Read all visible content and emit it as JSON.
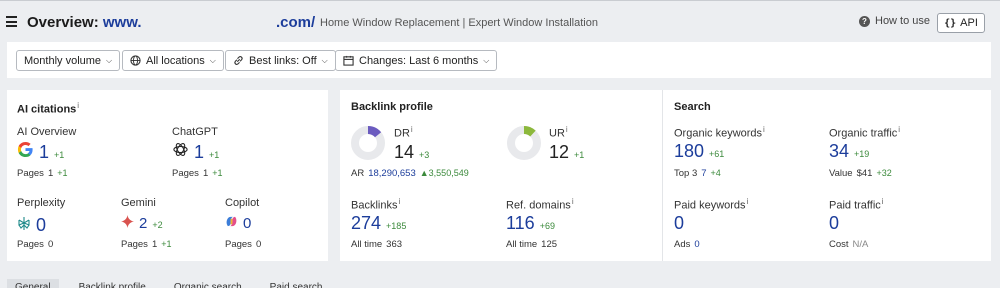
{
  "header": {
    "title_prefix": "Overview:",
    "domain_start": "www.",
    "domain_end": ".com/",
    "page_description": "Home Window Replacement | Expert Window Installation",
    "help_label": "How to use",
    "api_label": "API"
  },
  "filters": {
    "volume": "Monthly volume",
    "locations": "All locations",
    "best_links": "Best links: Off",
    "changes": "Changes: Last 6 months"
  },
  "ai_citations": {
    "title": "AI citations",
    "ai_overview": {
      "label": "AI Overview",
      "value": "1",
      "delta": "+1",
      "pages_label": "Pages",
      "pages": "1",
      "pages_delta": "+1"
    },
    "chatgpt": {
      "label": "ChatGPT",
      "value": "1",
      "delta": "+1",
      "pages_label": "Pages",
      "pages": "1",
      "pages_delta": "+1"
    },
    "perplexity": {
      "label": "Perplexity",
      "value": "0",
      "pages_label": "Pages",
      "pages": "0"
    },
    "gemini": {
      "label": "Gemini",
      "value": "2",
      "delta": "+2",
      "pages_label": "Pages",
      "pages": "1",
      "pages_delta": "+1"
    },
    "copilot": {
      "label": "Copilot",
      "value": "0",
      "pages_label": "Pages",
      "pages": "0"
    }
  },
  "backlink_profile": {
    "title": "Backlink profile",
    "dr": {
      "label": "DR",
      "value": "14",
      "delta": "+3",
      "fill": 0.14,
      "color": "#6b5bbf"
    },
    "ar": {
      "label": "AR",
      "value": "18,290,653",
      "delta": "3,550,549"
    },
    "ur": {
      "label": "UR",
      "value": "12",
      "delta": "+1",
      "fill": 0.12,
      "color": "#8cb83c"
    },
    "backlinks": {
      "label": "Backlinks",
      "value": "274",
      "delta": "+185",
      "sub_label": "All time",
      "sub_value": "363"
    },
    "ref_domains": {
      "label": "Ref. domains",
      "value": "116",
      "delta": "+69",
      "sub_label": "All time",
      "sub_value": "125"
    }
  },
  "search": {
    "title": "Search",
    "organic_keywords": {
      "label": "Organic keywords",
      "value": "180",
      "delta": "+61",
      "sub_label": "Top 3",
      "sub_value": "7",
      "sub_delta": "+4"
    },
    "organic_traffic": {
      "label": "Organic traffic",
      "value": "34",
      "delta": "+19",
      "sub_label": "Value",
      "sub_value": "$41",
      "sub_delta": "+32"
    },
    "paid_keywords": {
      "label": "Paid keywords",
      "value": "0",
      "sub_label": "Ads",
      "sub_value": "0"
    },
    "paid_traffic": {
      "label": "Paid traffic",
      "value": "0",
      "sub_label": "Cost",
      "sub_value": "N/A"
    }
  },
  "tabs": [
    "General",
    "Backlink profile",
    "Organic search",
    "Paid search"
  ]
}
